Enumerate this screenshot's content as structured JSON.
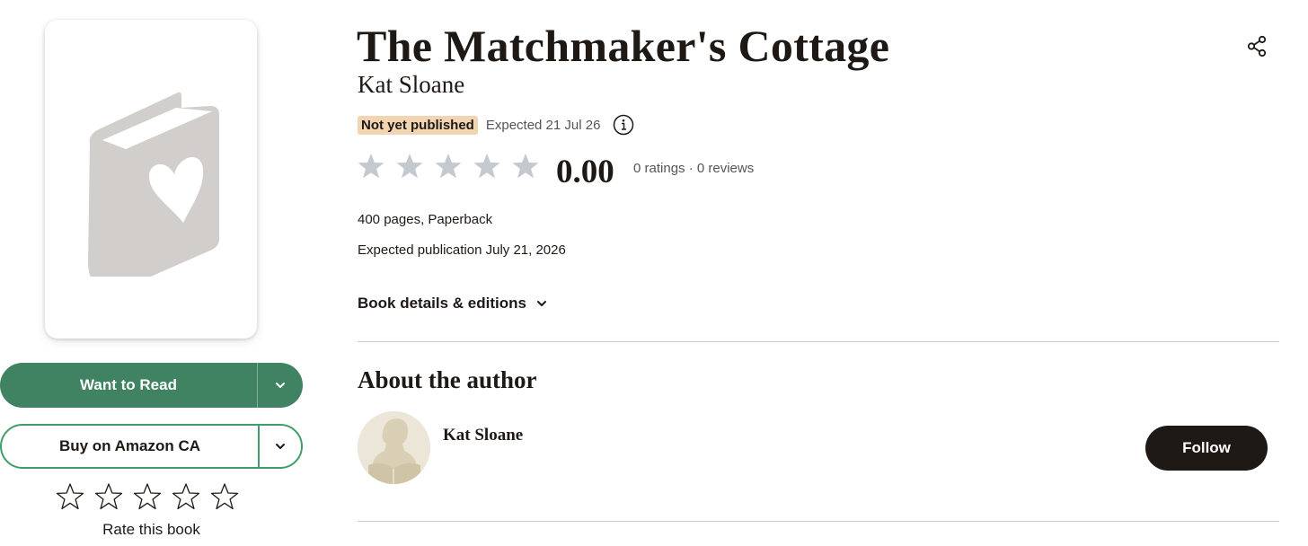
{
  "book": {
    "title": "The Matchmaker's Cottage",
    "author": "Kat Sloane",
    "status_badge": "Not yet published",
    "expected_short": "Expected 21 Jul 26",
    "average_rating": "0.00",
    "rating_counts": "0 ratings · 0 reviews",
    "format": "400 pages, Paperback",
    "publication": "Expected publication July 21, 2026",
    "details_link": "Book details & editions"
  },
  "actions": {
    "want_to_read": "Want to Read",
    "buy": "Buy on Amazon CA",
    "rate_label": "Rate this book"
  },
  "about": {
    "heading": "About the author",
    "author_name": "Kat Sloane",
    "follow_label": "Follow"
  },
  "colors": {
    "primary_green": "#3f8363",
    "badge_bg": "#f1d5b3",
    "star_grey": "#c4c8cf",
    "dark": "#1e1915"
  },
  "icons": [
    "book-heart-icon",
    "chevron-down-icon",
    "star-outline-icon",
    "share-icon",
    "info-icon",
    "star-filled-icon",
    "avatar-placeholder-icon"
  ]
}
